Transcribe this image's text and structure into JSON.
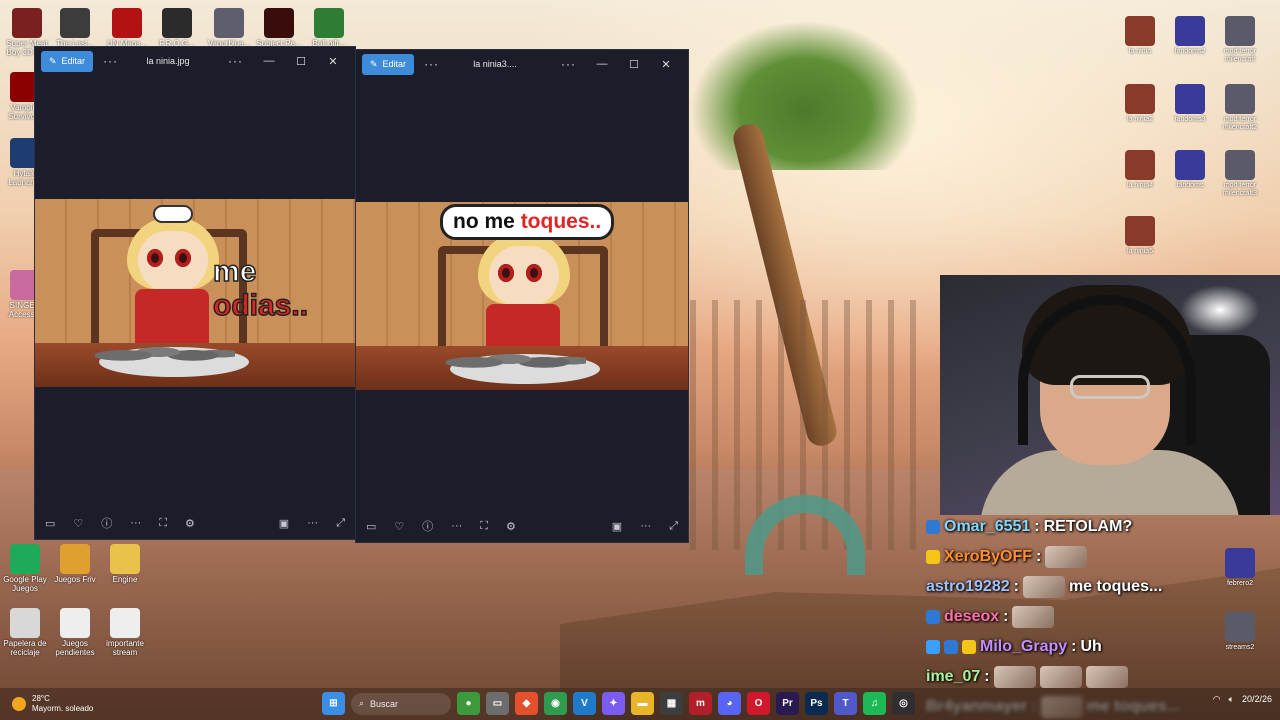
{
  "desktop_left_icons": [
    {
      "label": "Super Meat Boy 3D D...",
      "color": "#7a2020"
    },
    {
      "label": "The Last...",
      "color": "#3c3c3c"
    },
    {
      "label": "UN Maps...",
      "color": "#b31212"
    },
    {
      "label": "F.R.O.G...",
      "color": "#2b2b2b"
    },
    {
      "label": "Vaporblue...",
      "color": "#5e5e6e"
    },
    {
      "label": "Subject Pe...",
      "color": "#3a0c0c"
    },
    {
      "label": "Ball gift...",
      "color": "#2e7d32"
    },
    {
      "label": "Vampire Survivors",
      "color": "#8b0000"
    },
    {
      "label": "Hytale Launcher",
      "color": "#1e3c70"
    },
    {
      "label": "SINGER Access...",
      "color": "#c96aa0"
    },
    {
      "label": "Google Play Juegos",
      "color": "#1faa59"
    },
    {
      "label": "Juegos Friv",
      "color": "#e0a030"
    },
    {
      "label": "Engine",
      "color": "#e8c24a"
    },
    {
      "label": "Papelera de reciclaje",
      "color": "#d8d8d8"
    },
    {
      "label": "Juegos pendientes",
      "color": "#eeeeee"
    },
    {
      "label": "importante stream",
      "color": "#eeeeee"
    }
  ],
  "desktop_right_icons": [
    {
      "label": "la ninia"
    },
    {
      "label": "fandoms2"
    },
    {
      "label": "mod terror milencraft"
    },
    {
      "label": "la ninia2"
    },
    {
      "label": "fandoms3"
    },
    {
      "label": "mod terror milencraft2"
    },
    {
      "label": "la ninia4"
    },
    {
      "label": "fandoms"
    },
    {
      "label": "mod terror milencraft3"
    },
    {
      "label": "la ninia5"
    },
    {
      "label": "febrero2"
    },
    {
      "label": "streams2"
    }
  ],
  "window1": {
    "edit_label": "Editar",
    "more_label": "···",
    "title": "la ninia.jpg",
    "title_more": "···",
    "minimize": "—",
    "maximize": "☐",
    "close": "✕",
    "caption_white": "me ",
    "caption_red": "odias..",
    "bottom_more": "···",
    "bottom_more2": "···"
  },
  "window2": {
    "edit_label": "Editar",
    "more_label": "···",
    "title": "la ninia3....",
    "title_more": "···",
    "minimize": "—",
    "maximize": "☐",
    "close": "✕",
    "bubble_dark": "no me ",
    "bubble_red": "toques..",
    "bottom_more": "···",
    "bottom_more2": "···"
  },
  "chat": [
    {
      "user": "Omar_6551",
      "sep": ":",
      "message": "RETOLAM?",
      "user_color": "#7fd7ff",
      "badges": [
        "#2f78d6"
      ],
      "emotes": 0
    },
    {
      "user": "XeroByOFF",
      "sep": ":",
      "message": "",
      "user_color": "#ff8c2e",
      "badges": [
        "#f5c518"
      ],
      "emotes": 1
    },
    {
      "user": "astro19282",
      "sep": ":",
      "message": "me toques...",
      "user_color": "#9dc3ff",
      "badges": [],
      "emotes": 1
    },
    {
      "user": "deseox",
      "sep": ":",
      "message": "",
      "user_color": "#ff6fa8",
      "badges": [
        "#2f78d6"
      ],
      "emotes": 1
    },
    {
      "user": "Milo_Grapy",
      "sep": ":",
      "message": "Uh",
      "user_color": "#c58cff",
      "badges": [
        "#3aa0ff",
        "#2f78d6",
        "#f5c518"
      ],
      "emotes": 0
    },
    {
      "user": "ime_07",
      "sep": ":",
      "message": "",
      "user_color": "#a8f09a",
      "badges": [],
      "emotes": 3
    },
    {
      "user": "Br4yanmayer",
      "sep": ":",
      "message": "me toques...",
      "user_color": "#ffffff",
      "badges": [],
      "emotes": 1
    }
  ],
  "taskbar": {
    "temp": "28°C",
    "weather": "Mayorm. soleado",
    "search_placeholder": "Buscar",
    "apps": [
      {
        "name": "start-icon",
        "glyph": "⊞",
        "color": "#3a8ee6"
      },
      {
        "name": "wallet-icon",
        "glyph": "●",
        "color": "#3c9a3c"
      },
      {
        "name": "files-icon",
        "glyph": "▭",
        "color": "#6d6d6d"
      },
      {
        "name": "brave-icon",
        "glyph": "◆",
        "color": "#e5502c"
      },
      {
        "name": "chrome-icon",
        "glyph": "◉",
        "color": "#2e9b4f"
      },
      {
        "name": "vscode-icon",
        "glyph": "V",
        "color": "#1f7acc"
      },
      {
        "name": "copilot-icon",
        "glyph": "✦",
        "color": "#7a5cf0"
      },
      {
        "name": "folder-icon",
        "glyph": "▬",
        "color": "#e8b42a"
      },
      {
        "name": "store-icon",
        "glyph": "▦",
        "color": "#3d3d3d"
      },
      {
        "name": "app-m-icon",
        "glyph": "m",
        "color": "#b21e2a"
      },
      {
        "name": "discord-icon",
        "glyph": "◕",
        "color": "#5865f2"
      },
      {
        "name": "opera-icon",
        "glyph": "O",
        "color": "#d1182b"
      },
      {
        "name": "premiere-icon",
        "glyph": "Pr",
        "color": "#2a1a52"
      },
      {
        "name": "photoshop-icon",
        "glyph": "Ps",
        "color": "#0b2a4f"
      },
      {
        "name": "teams-icon",
        "glyph": "T",
        "color": "#5059c9"
      },
      {
        "name": "spotify-icon",
        "glyph": "♫",
        "color": "#1db954"
      },
      {
        "name": "obs-icon",
        "glyph": "◎",
        "color": "#302e31"
      }
    ],
    "date": "20/2/26"
  }
}
